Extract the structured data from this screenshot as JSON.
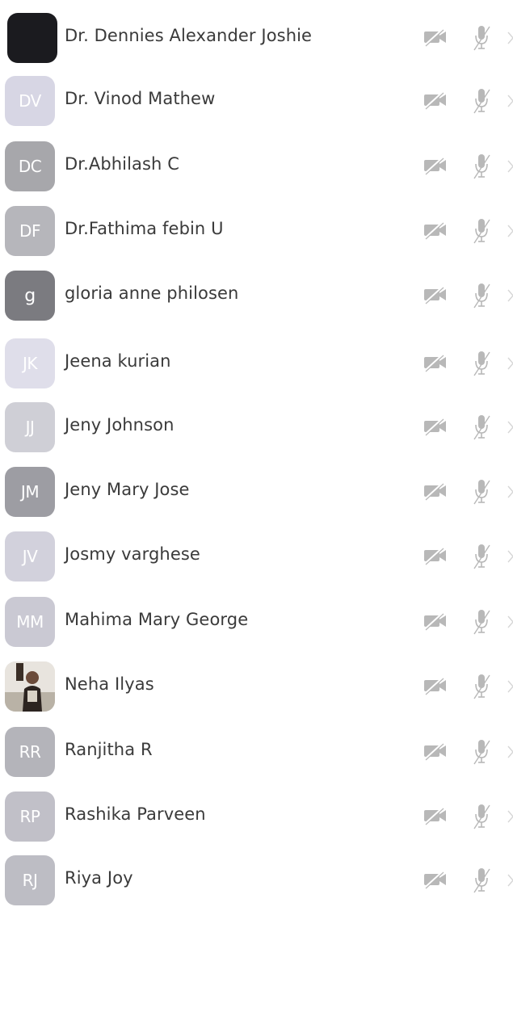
{
  "participants": [
    {
      "name": "Dr. Dennies Alexander Joshie",
      "initials": "",
      "avatar_style": "dark",
      "color": "#1b1b1f"
    },
    {
      "name": "Dr. Vinod Mathew",
      "initials": "DV",
      "avatar_style": "initials",
      "color": "#d7d6e4"
    },
    {
      "name": "Dr.Abhilash C",
      "initials": "DC",
      "avatar_style": "initials",
      "color": "#a7a7ab"
    },
    {
      "name": "Dr.Fathima febin U",
      "initials": "DF",
      "avatar_style": "initials",
      "color": "#b6b6bb"
    },
    {
      "name": "gloria anne philosen",
      "initials": "g",
      "avatar_style": "initials",
      "color": "#7b7b80"
    },
    {
      "name": "Jeena kurian",
      "initials": "JK",
      "avatar_style": "initials",
      "color": "#dfdeea"
    },
    {
      "name": "Jeny Johnson",
      "initials": "JJ",
      "avatar_style": "initials",
      "color": "#cfcfd6"
    },
    {
      "name": "Jeny Mary Jose",
      "initials": "JM",
      "avatar_style": "initials",
      "color": "#9d9da3"
    },
    {
      "name": "Josmy varghese",
      "initials": "JV",
      "avatar_style": "initials",
      "color": "#d2d1dc"
    },
    {
      "name": "Mahima Mary George",
      "initials": "MM",
      "avatar_style": "initials",
      "color": "#cac9d3"
    },
    {
      "name": "Neha Ilyas",
      "initials": "",
      "avatar_style": "photo",
      "color": "#e6e3de"
    },
    {
      "name": "Ranjitha R",
      "initials": "RR",
      "avatar_style": "initials",
      "color": "#b4b4ba"
    },
    {
      "name": "Rashika Parveen",
      "initials": "RP",
      "avatar_style": "initials",
      "color": "#c1c0c8"
    },
    {
      "name": "Riya Joy",
      "initials": "RJ",
      "avatar_style": "initials",
      "color": "#bdbdc4"
    }
  ],
  "icons": {
    "camera": "camera-off-icon",
    "microphone": "mic-off-icon",
    "chevron": "chevron-right-icon"
  },
  "colors": {
    "icon_gray": "#b8b8b8",
    "chevron_gray": "#d6d6d6",
    "name_text": "#3a3a3a"
  }
}
